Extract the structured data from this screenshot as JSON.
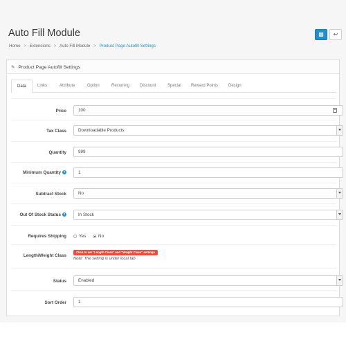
{
  "header": {
    "title": "Auto Fill Module",
    "save_icon": "save-icon",
    "back_icon": "reply-icon"
  },
  "breadcrumb": {
    "items": [
      "Home",
      "Extensions",
      "Auto Fill Module",
      "Product Page Autofill Settings"
    ]
  },
  "panel": {
    "title": "Product Page Autofill Settings",
    "title_icon": "pencil-icon"
  },
  "tabs": [
    "Data",
    "Links",
    "Attribute",
    "Option",
    "Recurring",
    "Discount",
    "Special",
    "Reward Points",
    "Design"
  ],
  "form": {
    "price": {
      "label": "Price",
      "value": "100"
    },
    "tax_class": {
      "label": "Tax Class",
      "value": "Downloadable Products"
    },
    "quantity": {
      "label": "Quantity",
      "value": "999"
    },
    "minimum_quantity": {
      "label": "Minimum Quantity",
      "value": "1"
    },
    "subtract_stock": {
      "label": "Subtract Stock",
      "value": "No"
    },
    "out_of_stock_status": {
      "label": "Out Of Stock Status",
      "value": "In Stock"
    },
    "requires_shipping": {
      "label": "Requires Shipping",
      "options": [
        "Yes",
        "No"
      ],
      "selected": "No"
    },
    "length_weight": {
      "label": "Length/Weight Class",
      "button": "Click to set \"Length Class\" and \"Weight Class\" settings",
      "note": "Note: The setting is under local tab"
    },
    "status": {
      "label": "Status",
      "value": "Enabled"
    },
    "sort_order": {
      "label": "Sort Order",
      "value": "1"
    }
  },
  "colors": {
    "primary": "#1e91cf",
    "alert": "#e74c3c"
  }
}
